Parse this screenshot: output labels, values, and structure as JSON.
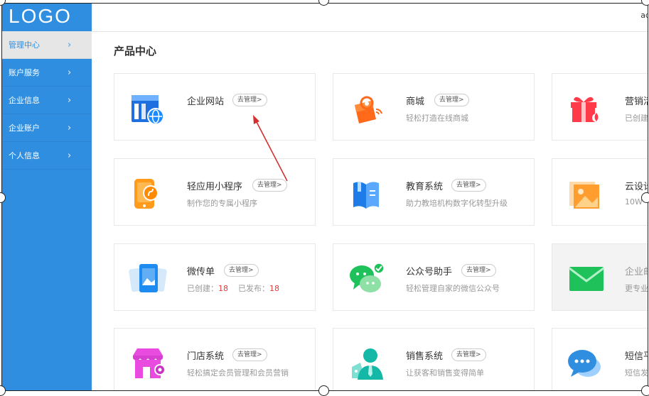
{
  "sidebar": {
    "logo": "LOGO",
    "items": [
      {
        "label": "管理中心",
        "active": true
      },
      {
        "label": "账户服务",
        "active": false
      },
      {
        "label": "企业信息",
        "active": false
      },
      {
        "label": "企业账户",
        "active": false
      },
      {
        "label": "个人信息",
        "active": false
      }
    ]
  },
  "header": {
    "user": "ad"
  },
  "section_title": "产品中心",
  "manage_label": "去管理>",
  "products": [
    {
      "title": "企业网站",
      "desc": "",
      "icon": "website-icon"
    },
    {
      "title": "商城",
      "desc": "轻松打造在线商城",
      "icon": "mall-icon"
    },
    {
      "title": "营销活",
      "desc": "已创建",
      "icon": "marketing-gift-icon"
    },
    {
      "title": "轻应用小程序",
      "desc": "制作您的专属小程序",
      "icon": "mini-program-icon"
    },
    {
      "title": "教育系统",
      "desc": "助力教培机构数字化转型升级",
      "icon": "education-book-icon"
    },
    {
      "title": "云设计",
      "desc": "10W",
      "icon": "cloud-design-icon"
    },
    {
      "title": "微传单",
      "desc": "",
      "icon": "flyer-icon",
      "stats": {
        "created_label": "已创建：",
        "created": "18",
        "published_label": "已发布：",
        "published": "18"
      }
    },
    {
      "title": "公众号助手",
      "desc": "轻松管理自家的微信公众号",
      "icon": "wechat-assistant-icon"
    },
    {
      "title": "企业邮",
      "desc": "更专业",
      "icon": "email-icon"
    },
    {
      "title": "门店系统",
      "desc": "轻松搞定会员管理和会员营销",
      "icon": "store-icon"
    },
    {
      "title": "销售系统",
      "desc": "让获客和销售变得简单",
      "icon": "sales-person-icon"
    },
    {
      "title": "短信平",
      "desc": "短信发",
      "icon": "sms-chat-icon"
    }
  ],
  "colors": {
    "sidebar": "#2f8ee0",
    "accent_red": "#e53935",
    "annotation_arrow": "#d32f2f"
  }
}
